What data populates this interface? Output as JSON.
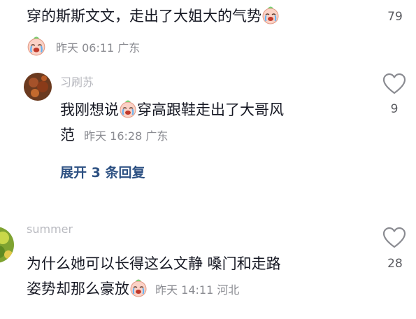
{
  "comment_top": {
    "text": "穿的斯斯文文，走出了大姐大的气势",
    "emoji_icon": "crying-laughing-face-icon",
    "time": "昨天 06:11",
    "location": "广东",
    "like_count": "79"
  },
  "reply": {
    "username": "习刷苏",
    "text_line1": "我刚想说",
    "text_line1_after_emoji": "穿高跟鞋走出了大哥风",
    "text_line2": "范",
    "emoji_icon": "crying-laughing-face-icon",
    "time": "昨天 16:28",
    "location": "广东",
    "like_count": "9"
  },
  "expand_replies": {
    "label": "展开 3 条回复"
  },
  "comment_bottom": {
    "username": "summer",
    "text_line1": "为什么她可以长得这么文静 嗓门和走路",
    "text_line2": "姿势却那么豪放",
    "emoji_icon": "crying-laughing-face-icon",
    "time": "昨天 14:11",
    "location": "河北",
    "like_count": "28"
  },
  "colors": {
    "text": "#161823",
    "meta": "#8a8b91",
    "link": "#2c5082",
    "heart_outline": "#8a8b91"
  }
}
